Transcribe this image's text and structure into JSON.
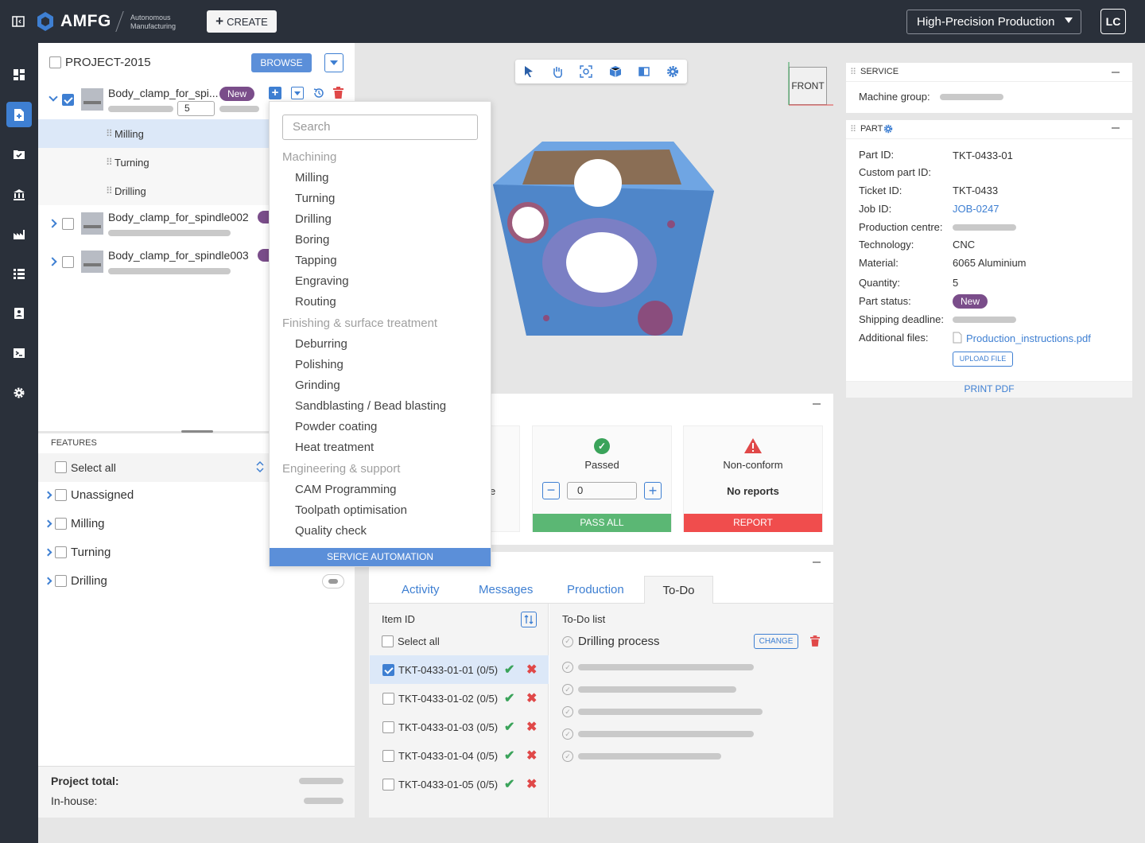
{
  "header": {
    "brand": "AMFG",
    "tagline_1": "Autonomous",
    "tagline_2": "Manufacturing",
    "create_label": "CREATE",
    "workspace_select": "High-Precision Production",
    "user_initials": "LC"
  },
  "project": {
    "name": "PROJECT-2015",
    "browse_label": "BROWSE",
    "parts": [
      {
        "name": "Body_clamp_for_spi...",
        "status": "New",
        "qty": "5"
      },
      {
        "name": "Body_clamp_for_spindle002"
      },
      {
        "name": "Body_clamp_for_spindle003"
      }
    ],
    "processes": [
      "Milling",
      "Turning",
      "Drilling"
    ]
  },
  "dropdown": {
    "search_placeholder": "Search",
    "groups": [
      {
        "title": "Machining",
        "items": [
          "Milling",
          "Turning",
          "Drilling",
          "Boring",
          "Tapping",
          "Engraving",
          "Routing"
        ]
      },
      {
        "title": "Finishing & surface treatment",
        "items": [
          "Deburring",
          "Polishing",
          "Grinding",
          "Sandblasting / Bead blasting",
          "Powder coating",
          "Heat treatment"
        ]
      },
      {
        "title": "Engineering & support",
        "items": [
          "CAM Programming",
          "Toolpath optimisation",
          "Quality check"
        ]
      }
    ],
    "footer": "SERVICE AUTOMATION"
  },
  "features": {
    "title": "FEATURES",
    "select_all": "Select all",
    "groups": [
      "Unassigned",
      "Milling",
      "Turning",
      "Drilling"
    ]
  },
  "totals": {
    "project_total": "Project total:",
    "in_house": "In-house:"
  },
  "viewer": {
    "front_label": "FRONT"
  },
  "quality": {
    "partial_text": "e",
    "passed_label": "Passed",
    "passed_value": "0",
    "pass_all": "PASS ALL",
    "nonconform_label": "Non-conform",
    "no_reports": "No reports",
    "report": "REPORT"
  },
  "tabs": [
    "Activity",
    "Messages",
    "Production",
    "To-Do"
  ],
  "items": {
    "header": "Item ID",
    "select_all": "Select all",
    "rows": [
      {
        "id": "TKT-0433-01-01",
        "count": "(0/5)",
        "checked": true
      },
      {
        "id": "TKT-0433-01-02",
        "count": "(0/5)",
        "checked": false
      },
      {
        "id": "TKT-0433-01-03",
        "count": "(0/5)",
        "checked": false
      },
      {
        "id": "TKT-0433-01-04",
        "count": "(0/5)",
        "checked": false
      },
      {
        "id": "TKT-0433-01-05",
        "count": "(0/5)",
        "checked": false
      }
    ]
  },
  "todo": {
    "header": "To-Do list",
    "process": "Drilling process",
    "change": "CHANGE"
  },
  "service": {
    "title": "SERVICE",
    "machine_group": "Machine group:"
  },
  "part": {
    "title": "PART",
    "fields": {
      "part_id_label": "Part ID:",
      "part_id": "TKT-0433-01",
      "custom_label": "Custom part ID:",
      "ticket_label": "Ticket ID:",
      "ticket": "TKT-0433",
      "job_label": "Job ID:",
      "job": "JOB-0247",
      "centre_label": "Production centre:",
      "tech_label": "Technology:",
      "tech": "CNC",
      "material_label": "Material:",
      "material": "6065 Aluminium",
      "qty_label": "Quantity:",
      "qty": "5",
      "status_label": "Part status:",
      "status": "New",
      "deadline_label": "Shipping deadline:",
      "files_label": "Additional files:",
      "file": "Production_instructions.pdf"
    },
    "upload": "UPLOAD FILE",
    "print": "PRINT PDF"
  }
}
